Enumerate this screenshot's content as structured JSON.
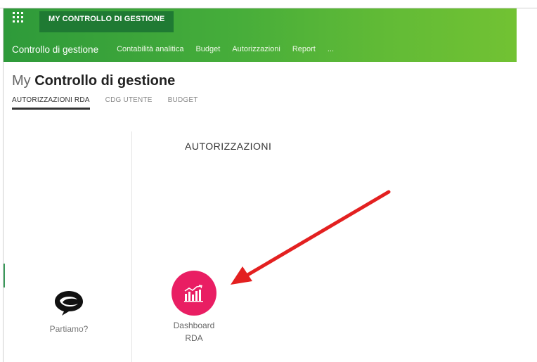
{
  "header": {
    "brand_tab": "MY CONTROLLO DI GESTIONE",
    "nav_main": "Controllo di gestione",
    "nav_items": [
      "Contabilità analitica",
      "Budget",
      "Autorizzazioni",
      "Report",
      "..."
    ]
  },
  "page": {
    "title_prefix": "My",
    "title_main": "Controllo di gestione",
    "tabs": [
      {
        "label": "AUTORIZZAZIONI RDA",
        "active": true
      },
      {
        "label": "CDG UTENTE",
        "active": false
      },
      {
        "label": "BUDGET",
        "active": false
      }
    ]
  },
  "content": {
    "section_title": "AUTORIZZAZIONI",
    "partiamo_label": "Partiamo?",
    "dashboard_label_line1": "Dashboard",
    "dashboard_label_line2": "RDA"
  },
  "colors": {
    "header_green_start": "#2e9a3a",
    "header_green_end": "#72c233",
    "brand_tab_bg": "#1f7a33",
    "dashboard_icon_bg": "#e91e63",
    "annotation_arrow": "#e32020"
  },
  "icons": {
    "apps": "grid-icon",
    "partiamo": "speech-bubble-logo-icon",
    "dashboard": "bar-chart-trend-icon",
    "annotation": "red-arrow-annotation"
  }
}
